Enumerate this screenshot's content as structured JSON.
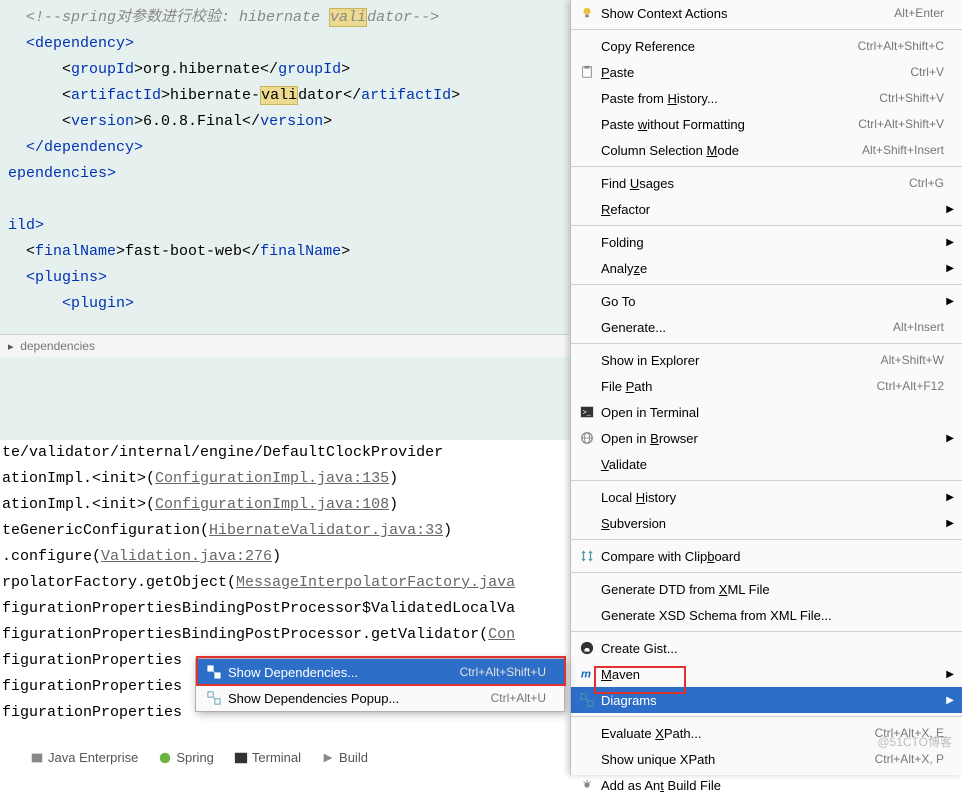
{
  "code": {
    "line1": "  <!--spring对参数进行校验: hibernate validator-->",
    "line2_open": "  <dependency>",
    "line3_a": "      <",
    "line3_b": "groupId",
    "line3_c": ">org.hibernate</",
    "line3_d": "groupId",
    "line3_e": ">",
    "line4_a": "      <",
    "line4_b": "artifactId",
    "line4_c": ">hibernate-",
    "line4_hl": "vali",
    "line4_d": "dator</",
    "line4_e": "artifactId",
    "line4_f": ">",
    "line5_a": "      <",
    "line5_b": "version",
    "line5_c": ">6.0.8.Final</",
    "line5_d": "version",
    "line5_e": ">",
    "line6": "  </dependency>",
    "line7": "ependencies>",
    "line8": "ild>",
    "line9_a": "  <",
    "line9_b": "finalName",
    "line9_c": ">fast-boot-web</",
    "line9_d": "finalName",
    "line9_e": ">",
    "line10": "  <plugins>",
    "line11": "      <plugin>"
  },
  "breadcrumb": "  dependencies",
  "console": {
    "l1": "te/validator/internal/engine/DefaultClockProvider",
    "l2a": "ationImpl.<init>(",
    "l2b": "ConfigurationImpl.java:135",
    "l2c": ")",
    "l3a": "ationImpl.<init>(",
    "l3b": "ConfigurationImpl.java:108",
    "l3c": ")",
    "l4a": "teGenericConfiguration(",
    "l4b": "HibernateValidator.java:33",
    "l4c": ")",
    "l5a": ".configure(",
    "l5b": "Validation.java:276",
    "l5c": ")",
    "l6a": "rpolatorFactory.getObject(",
    "l6b": "MessageInterpolatorFactory.java",
    "l6c": "",
    "l7": "figurationPropertiesBindingPostProcessor$ValidatedLocalVa",
    "l8a": "figurationPropertiesBindingPostProcessor.getValidator(",
    "l8b": "Con",
    "l9": "figurationProperties",
    "l10": "figurationProperties",
    "l11": "figurationProperties"
  },
  "submenu": {
    "item1": "Show Dependencies...",
    "shortcut1": "Ctrl+Alt+Shift+U",
    "item2": "Show Dependencies Popup...",
    "shortcut2": "Ctrl+Alt+U"
  },
  "tabs": {
    "java_enterprise": "Java Enterprise",
    "spring": "Spring",
    "terminal": "Terminal",
    "build": "Build"
  },
  "menu": [
    {
      "label": "Show Context Actions",
      "shortcut": "Alt+Enter",
      "icon": "bulb"
    },
    {
      "sep": true
    },
    {
      "label": "Copy Reference",
      "shortcut": "Ctrl+Alt+Shift+C"
    },
    {
      "label": "Paste",
      "u": 0,
      "shortcut": "Ctrl+V",
      "icon": "paste"
    },
    {
      "label": "Paste from History...",
      "u": 11,
      "shortcut": "Ctrl+Shift+V"
    },
    {
      "label": "Paste without Formatting",
      "u": 6,
      "shortcut": "Ctrl+Alt+Shift+V"
    },
    {
      "label": "Column Selection Mode",
      "u": 17,
      "shortcut": "Alt+Shift+Insert"
    },
    {
      "sep": true
    },
    {
      "label": "Find Usages",
      "u": 5,
      "shortcut": "Ctrl+G"
    },
    {
      "label": "Refactor",
      "u": 0,
      "arrow": true
    },
    {
      "sep": true
    },
    {
      "label": "Folding",
      "arrow": true
    },
    {
      "label": "Analyze",
      "u": 5,
      "arrow": true
    },
    {
      "sep": true
    },
    {
      "label": "Go To",
      "arrow": true
    },
    {
      "label": "Generate...",
      "shortcut": "Alt+Insert"
    },
    {
      "sep": true
    },
    {
      "label": "Show in Explorer",
      "shortcut": "Alt+Shift+W"
    },
    {
      "label": "File Path",
      "u": 5,
      "shortcut": "Ctrl+Alt+F12"
    },
    {
      "label": "Open in Terminal",
      "icon": "terminal"
    },
    {
      "label": "Open in Browser",
      "u": 8,
      "arrow": true,
      "icon": "globe"
    },
    {
      "label": "Validate",
      "u": 0
    },
    {
      "sep": true
    },
    {
      "label": "Local History",
      "u": 6,
      "arrow": true
    },
    {
      "label": "Subversion",
      "u": 0,
      "arrow": true
    },
    {
      "sep": true
    },
    {
      "label": "Compare with Clipboard",
      "u": 17,
      "icon": "compare"
    },
    {
      "sep": true
    },
    {
      "label": "Generate DTD from XML File",
      "u": 18
    },
    {
      "label": "Generate XSD Schema from XML File..."
    },
    {
      "sep": true
    },
    {
      "label": "Create Gist...",
      "icon": "github"
    },
    {
      "label": "Maven",
      "u": 0,
      "arrow": true,
      "icon": "maven"
    },
    {
      "label": "Diagrams",
      "arrow": true,
      "selected": true,
      "icon": "diagram"
    },
    {
      "sep": true
    },
    {
      "label": "Evaluate XPath...",
      "u": 9,
      "shortcut": "Ctrl+Alt+X, E"
    },
    {
      "label": "Show unique XPath",
      "shortcut": "Ctrl+Alt+X, P"
    },
    {
      "label": "Add as Ant Build File",
      "u": 9,
      "icon": "ant"
    }
  ],
  "watermark": "@51CTO博客"
}
